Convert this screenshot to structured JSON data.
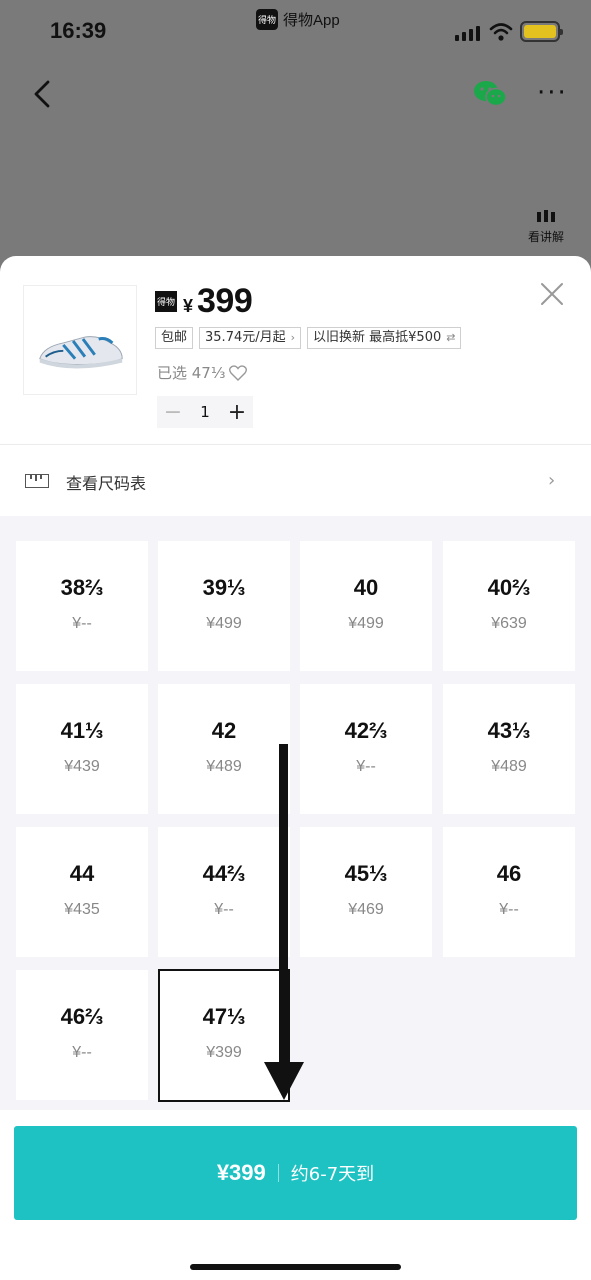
{
  "status_bar": {
    "time": "16:39",
    "app_caption": "得物App",
    "app_logo_text": "得物"
  },
  "header": {
    "explain_label": "看讲解"
  },
  "product": {
    "logo_text": "得物",
    "currency": "¥",
    "price": "399",
    "tags": [
      {
        "label": "包邮"
      },
      {
        "label": "35.74元/月起",
        "suffix": "›"
      },
      {
        "label": "以旧换新  最高抵¥500",
        "suffix": "⇄"
      }
    ],
    "selected_label": "已选 47⅓",
    "quantity": "1"
  },
  "size_chart": {
    "label": "查看尺码表"
  },
  "sizes": [
    {
      "size": "38⅔",
      "price": "¥--"
    },
    {
      "size": "39⅓",
      "price": "¥499"
    },
    {
      "size": "40",
      "price": "¥499"
    },
    {
      "size": "40⅔",
      "price": "¥639"
    },
    {
      "size": "41⅓",
      "price": "¥439"
    },
    {
      "size": "42",
      "price": "¥489"
    },
    {
      "size": "42⅔",
      "price": "¥--"
    },
    {
      "size": "43⅓",
      "price": "¥489"
    },
    {
      "size": "44",
      "price": "¥435"
    },
    {
      "size": "44⅔",
      "price": "¥--"
    },
    {
      "size": "45⅓",
      "price": "¥469"
    },
    {
      "size": "46",
      "price": "¥--"
    },
    {
      "size": "46⅔",
      "price": "¥--"
    },
    {
      "size": "47⅓",
      "price": "¥399",
      "selected": true
    }
  ],
  "buy_button": {
    "amount": "¥399",
    "eta": "约6-7天到"
  },
  "colors": {
    "accent": "#1ec2c2",
    "overlay": "#7a7a7a"
  }
}
